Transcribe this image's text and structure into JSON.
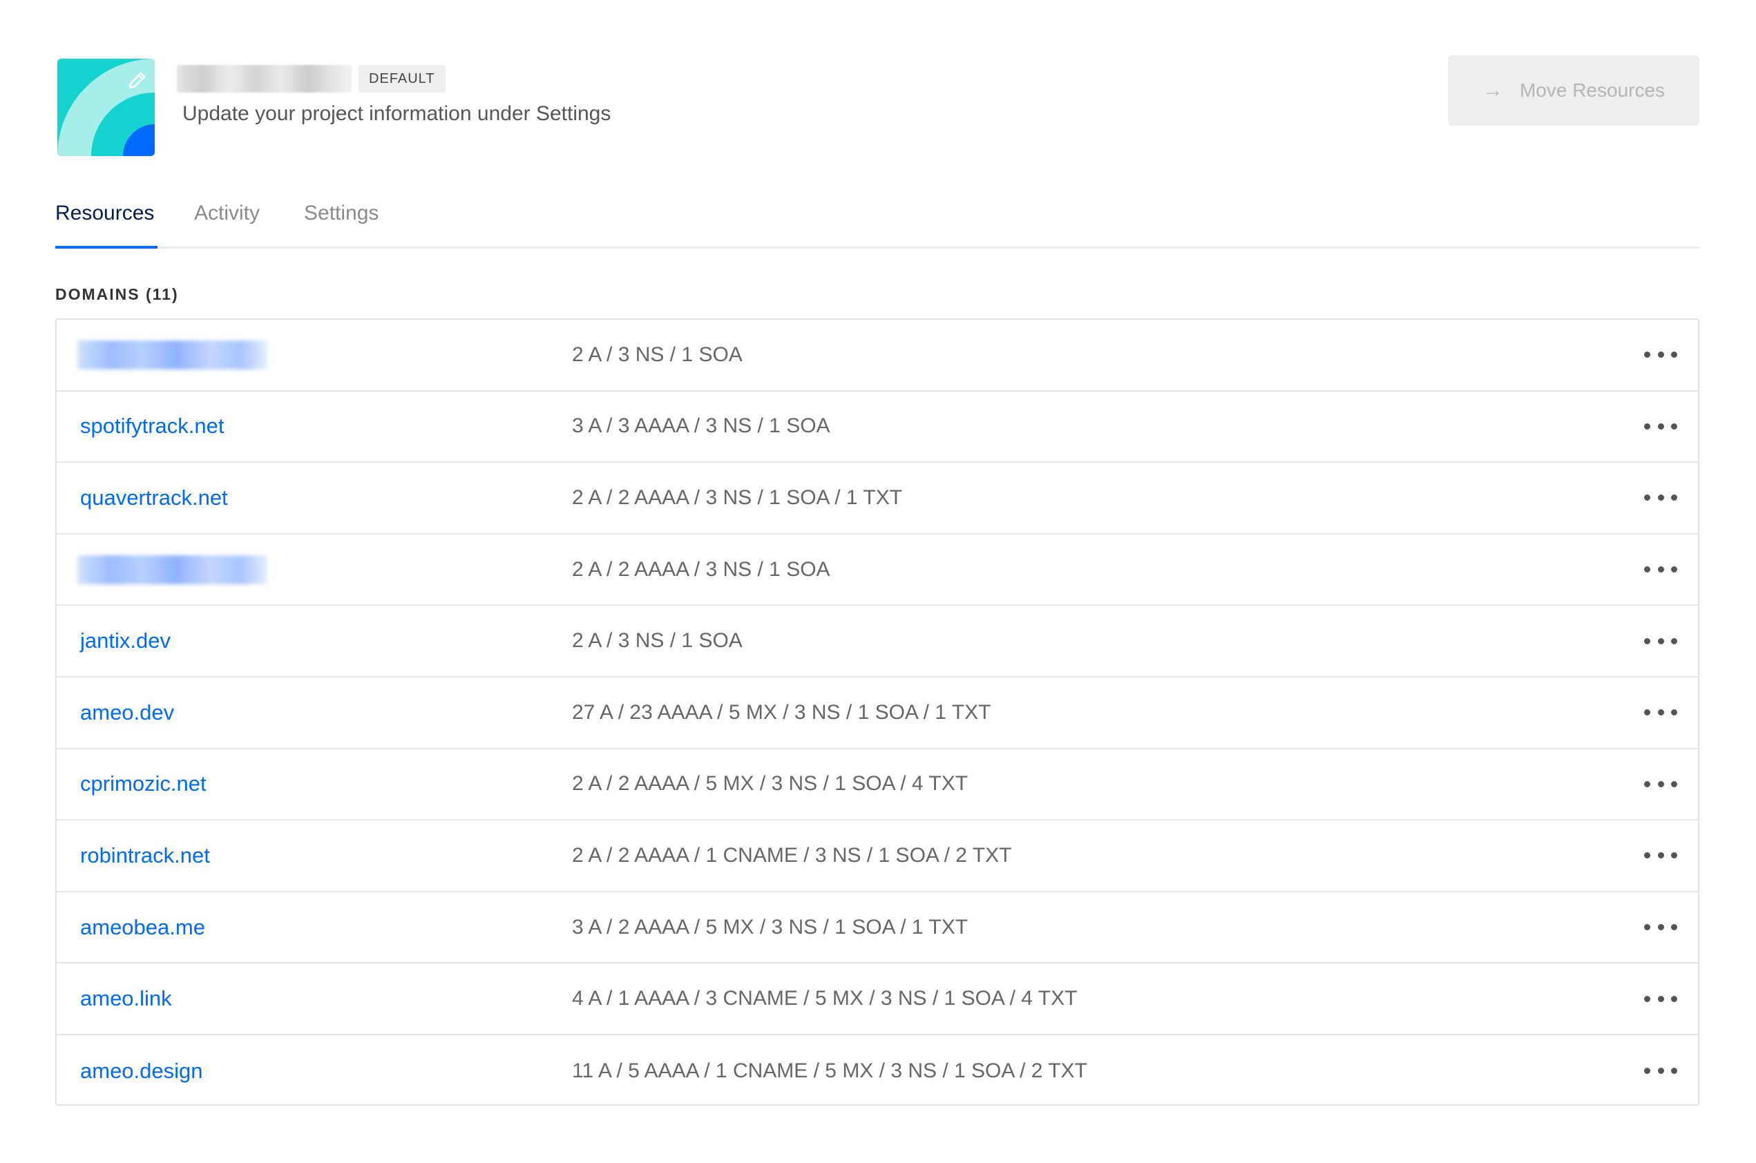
{
  "header": {
    "project_name": "",
    "badge": "DEFAULT",
    "subtitle": "Update your project information under Settings",
    "move_button": "Move Resources"
  },
  "tabs": [
    {
      "label": "Resources",
      "active": true
    },
    {
      "label": "Activity",
      "active": false
    },
    {
      "label": "Settings",
      "active": false
    }
  ],
  "domains": {
    "title": "DOMAINS (11)",
    "rows": [
      {
        "name": "",
        "blurred": true,
        "records": "2 A / 3 NS / 1 SOA"
      },
      {
        "name": "spotifytrack.net",
        "records": "3 A / 3 AAAA / 3 NS / 1 SOA"
      },
      {
        "name": "quavertrack.net",
        "records": "2 A / 2 AAAA / 3 NS / 1 SOA / 1 TXT"
      },
      {
        "name": "",
        "blurred": true,
        "records": "2 A / 2 AAAA / 3 NS / 1 SOA"
      },
      {
        "name": "jantix.dev",
        "records": "2 A / 3 NS / 1 SOA"
      },
      {
        "name": "ameo.dev",
        "records": "27 A / 23 AAAA / 5 MX / 3 NS / 1 SOA / 1 TXT"
      },
      {
        "name": "cprimozic.net",
        "records": "2 A / 2 AAAA / 5 MX / 3 NS / 1 SOA / 4 TXT"
      },
      {
        "name": "robintrack.net",
        "records": "2 A / 2 AAAA / 1 CNAME / 3 NS / 1 SOA / 2 TXT"
      },
      {
        "name": "ameobea.me",
        "records": "3 A / 2 AAAA / 5 MX / 3 NS / 1 SOA / 1 TXT"
      },
      {
        "name": "ameo.link",
        "records": "4 A / 1 AAAA / 3 CNAME / 5 MX / 3 NS / 1 SOA / 4 TXT"
      },
      {
        "name": "ameo.design",
        "records": "11 A / 5 AAAA / 1 CNAME / 5 MX / 3 NS / 1 SOA / 2 TXT"
      }
    ]
  },
  "icons": {
    "edit": "pencil-icon",
    "move": "arrow-right-icon",
    "row_menu": "more-horizontal-icon"
  },
  "colors": {
    "accent": "#0069ff",
    "nav_active": "#031b4e",
    "logo_teal": "#14d3cf",
    "logo_blue": "#0069ff"
  }
}
